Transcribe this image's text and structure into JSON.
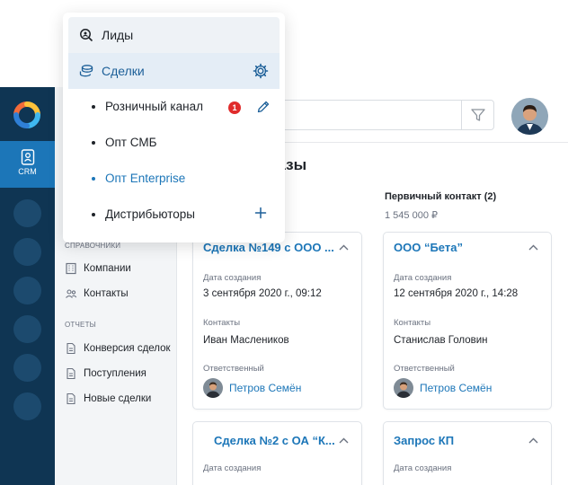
{
  "app": {
    "rail_tab_label": "CRM"
  },
  "menu": {
    "leads_label": "Лиды",
    "deals_label": "Сделки",
    "pipelines": [
      {
        "label": "Розничный канал",
        "badge": "1",
        "state": "normal"
      },
      {
        "label": "Опт СМБ",
        "state": "normal"
      },
      {
        "label": "Опт Enterprise",
        "state": "active"
      },
      {
        "label": "Дистрибьюторы",
        "state": "normal"
      }
    ]
  },
  "sidebar": {
    "section_directories_partial": "СПРАВОЧНИКИ",
    "directories": [
      {
        "label": "Компании"
      },
      {
        "label": "Контакты"
      }
    ],
    "section_reports": "ОТЧЕТЫ",
    "reports": [
      {
        "label": "Конверсия сделок"
      },
      {
        "label": "Поступления"
      },
      {
        "label": "Новые сделки"
      }
    ]
  },
  "main": {
    "title_partial": "казы",
    "columns": [
      {
        "header": "",
        "sum": "",
        "cards": [
          {
            "title": "Сделка №149 с ООО ...",
            "created_label": "Дата создания",
            "created": "3 сентября 2020 г., 09:12",
            "contacts_label": "Контакты",
            "contact": "Иван Маслеников",
            "owner_label": "Ответственный",
            "owner": "Петров Семён"
          },
          {
            "title": "Сделка №2 с ОА “К...",
            "created_label": "Дата создания"
          }
        ]
      },
      {
        "header": "Первичный контакт (2)",
        "sum": "1 545 000 ₽",
        "cards": [
          {
            "title": "ООО “Бета”",
            "created_label": "Дата создания",
            "created": "12 сентября 2020 г., 14:28",
            "contacts_label": "Контакты",
            "contact": "Станислав Головин",
            "owner_label": "Ответственный",
            "owner": "Петров Семён"
          },
          {
            "title": "Запрос КП",
            "created_label": "Дата создания"
          }
        ]
      }
    ]
  },
  "colors": {
    "accent": "#1c76b8",
    "rail": "#0f3553",
    "badge": "#e02b2b"
  }
}
